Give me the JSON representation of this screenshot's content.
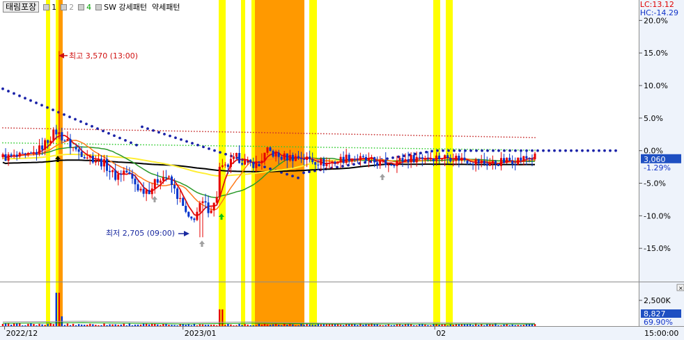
{
  "legend": {
    "stock_name": "태림포장",
    "items": [
      {
        "label": "1",
        "color": "#000000"
      },
      {
        "label": "2",
        "color": "#9a9a9a"
      },
      {
        "label": "4",
        "color": "#00a000"
      },
      {
        "label": "SW 강세패턴  약세패턴",
        "color": "#000000"
      }
    ]
  },
  "top_right": {
    "lc": "LC:13.12",
    "hc": "HC:-14.29"
  },
  "annotations": {
    "high": "최고 3,570 (13:00)",
    "low": "최저 2,705 (09:00)"
  },
  "price_badge": "3,060",
  "price_change": "-1.29%",
  "volume_badge": "8,827",
  "volume_pct": "69.90%",
  "volume_tick": "2,500K",
  "x_axis_labels": [
    {
      "text": "2022/12",
      "pos": 0.005
    },
    {
      "text": "2023/01",
      "pos": 0.285
    },
    {
      "text": "02",
      "pos": 0.68
    }
  ],
  "x_axis_right": "15:00:00",
  "colors": {
    "yellow": "#ffff00",
    "orange": "#ff9900",
    "up": "#e60000",
    "down": "#0033cc",
    "badge": "#1e4fc2"
  },
  "chart_data": {
    "type": "candlestick",
    "y_axis_ticks": [
      "20.0%",
      "15.0%",
      "10.0%",
      "5.0%",
      "0.0%",
      "-5.0%",
      "-10.0%",
      "-15.0%"
    ],
    "y_range_pct": [
      -20,
      21
    ],
    "y_tick_values": [
      20,
      15,
      10,
      5,
      0,
      -5,
      -10,
      -15
    ],
    "high_low": {
      "high": 3570,
      "low": 2705,
      "last": 3060
    },
    "series": [
      {
        "name": "1",
        "color": "#000000"
      },
      {
        "name": "2",
        "color": "#9a9a9a"
      },
      {
        "name": "4",
        "color": "#00a000"
      }
    ],
    "patterns": [
      "SW 강세패턴",
      "약세패턴"
    ]
  }
}
